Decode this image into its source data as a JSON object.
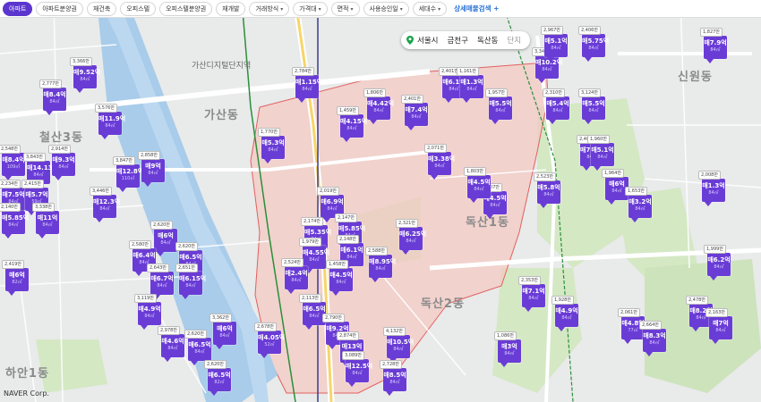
{
  "filters": [
    {
      "label": "아파트",
      "active": true,
      "dropdown": false
    },
    {
      "label": "아파트분양권",
      "active": false,
      "dropdown": false
    },
    {
      "label": "재건축",
      "active": false,
      "dropdown": false
    },
    {
      "label": "오피스텔",
      "active": false,
      "dropdown": false
    },
    {
      "label": "오피스텔분양권",
      "active": false,
      "dropdown": false
    },
    {
      "label": "재개발",
      "active": false,
      "dropdown": false
    },
    {
      "label": "거래방식",
      "active": false,
      "dropdown": true
    },
    {
      "label": "가격대",
      "active": false,
      "dropdown": true
    },
    {
      "label": "면적",
      "active": false,
      "dropdown": true
    },
    {
      "label": "사용승인일",
      "active": false,
      "dropdown": true
    },
    {
      "label": "세대수",
      "active": false,
      "dropdown": true
    }
  ],
  "advanced_search_label": "상세매물검색 +",
  "search": {
    "city": "서울시",
    "district": "금천구",
    "dong": "독산동",
    "suffix": "단지"
  },
  "area_labels": [
    {
      "text": "가산동"
    },
    {
      "text": "철산3동"
    },
    {
      "text": "독산2동"
    },
    {
      "text": "독산1동"
    },
    {
      "text": "신원동"
    },
    {
      "text": "하안1동"
    },
    {
      "text": "가산디지털단지역"
    }
  ],
  "markers": [
    {
      "value": "매9.52억",
      "area": "84㎡",
      "price": "3,366만"
    },
    {
      "value": "매8.4억",
      "area": "84㎡",
      "price": "2,777만"
    },
    {
      "value": "매11.9억",
      "area": "84㎡",
      "price": "3,576만"
    },
    {
      "value": "매8.4억",
      "area": "109㎡",
      "price": "2,548만"
    },
    {
      "value": "매14.13억",
      "area": "84㎡",
      "price": "3,843만"
    },
    {
      "value": "매9.3억",
      "area": "84㎡",
      "price": "2,914만"
    },
    {
      "value": "매7.5억",
      "area": "84㎡",
      "price": "2,234만"
    },
    {
      "value": "매5.7억",
      "area": "59㎡",
      "price": "2,415만"
    },
    {
      "value": "매12.8억",
      "area": "110㎡",
      "price": "3,847만"
    },
    {
      "value": "매9억",
      "area": "84㎡",
      "price": "2,858만"
    },
    {
      "value": "매12.3억",
      "area": "84㎡",
      "price": "3,446만"
    },
    {
      "value": "매5.85억",
      "area": "84㎡",
      "price": "2,140만"
    },
    {
      "value": "매11억",
      "area": "84㎡",
      "price": "3,338만"
    },
    {
      "value": "매6억",
      "area": "84㎡",
      "price": "2,620만"
    },
    {
      "value": "매6.4억",
      "area": "84㎡",
      "price": "2,580만"
    },
    {
      "value": "매6.5억",
      "area": "84㎡",
      "price": "2,620만"
    },
    {
      "value": "매6억",
      "area": "82㎡",
      "price": "2,419만"
    },
    {
      "value": "매6.7억",
      "area": "84㎡",
      "price": "2,643만"
    },
    {
      "value": "매6.15억",
      "area": "84㎡",
      "price": "2,651만"
    },
    {
      "value": "매4.9억",
      "area": "84㎡",
      "price": "3,119만"
    },
    {
      "value": "매4.6억",
      "area": "84㎡",
      "price": "2,978만"
    },
    {
      "value": "매6.5억",
      "area": "84㎡",
      "price": "2,620만"
    },
    {
      "value": "매6억",
      "area": "84㎡",
      "price": "3,362만"
    },
    {
      "value": "매6.5억",
      "area": "82㎡",
      "price": "2,620만"
    },
    {
      "value": "매4.05억",
      "area": "52㎡",
      "price": "2,678만"
    },
    {
      "value": "매1.15억",
      "area": "84㎡",
      "price": "2,784만"
    },
    {
      "value": "매5.3억",
      "area": "84㎡",
      "price": "1,770만"
    },
    {
      "value": "매4.15억",
      "area": "84㎡",
      "price": "1,459만"
    },
    {
      "value": "매6.9억",
      "area": "84㎡",
      "price": "2,019만"
    },
    {
      "value": "매5.35억",
      "area": "84㎡",
      "price": "2,174만"
    },
    {
      "value": "매5.85억",
      "area": "84㎡",
      "price": "2,147만"
    },
    {
      "value": "매4.55억",
      "area": "84㎡",
      "price": "1,979만"
    },
    {
      "value": "매6.1억",
      "area": "84㎡",
      "price": "2,148만"
    },
    {
      "value": "매2.4억",
      "area": "84㎡",
      "price": "2,524만"
    },
    {
      "value": "매6.5억",
      "area": "84㎡",
      "price": "2,113만"
    },
    {
      "value": "매8.95억",
      "area": "84㎡",
      "price": "2,588만"
    },
    {
      "value": "매4.5억",
      "area": "84㎡",
      "price": "1,458만"
    },
    {
      "value": "매9.2억",
      "area": "84㎡",
      "price": "2,790만"
    },
    {
      "value": "매13억",
      "area": "84㎡",
      "price": "2,874만"
    },
    {
      "value": "매12.5억",
      "area": "84㎡",
      "price": "3,089만"
    },
    {
      "value": "매10.5억",
      "area": "84㎡",
      "price": "4,132만"
    },
    {
      "value": "매8.5억",
      "area": "84㎡",
      "price": "2,728만"
    },
    {
      "value": "매6.25억",
      "area": "84㎡",
      "price": "2,321만"
    },
    {
      "value": "매3.38억",
      "area": "84㎡",
      "price": "2,071만"
    },
    {
      "value": "매4.5억",
      "area": "84㎡",
      "price": "1,907만"
    },
    {
      "value": "매7.4억",
      "area": "84㎡",
      "price": "2,401만"
    },
    {
      "value": "매6.1억",
      "area": "84㎡",
      "price": "2,401만"
    },
    {
      "value": "매1.3억",
      "area": "84㎡",
      "price": "1,161만"
    },
    {
      "value": "매4.42억",
      "area": "84㎡",
      "price": "1,806만"
    },
    {
      "value": "매5.5억",
      "area": "84㎡",
      "price": "1,957만"
    },
    {
      "value": "매4.5억",
      "area": "84㎡",
      "price": "1,803만"
    },
    {
      "value": "매10.2억",
      "area": "84㎡",
      "price": "3,342만"
    },
    {
      "value": "매5.1억",
      "area": "84㎡",
      "price": "2,967만"
    },
    {
      "value": "매5.75억",
      "area": "84㎡",
      "price": "2,406만"
    },
    {
      "value": "매5.4억",
      "area": "84㎡",
      "price": "2,310만"
    },
    {
      "value": "매5.5억",
      "area": "84㎡",
      "price": "3,124만"
    },
    {
      "value": "매7.55억",
      "area": "84㎡",
      "price": "2,400만"
    },
    {
      "value": "매6억",
      "area": "84㎡",
      "price": "1,964만"
    },
    {
      "value": "매3.2억",
      "area": "84㎡",
      "price": "1,653만"
    },
    {
      "value": "매5.8억",
      "area": "84㎡",
      "price": "2,523만"
    },
    {
      "value": "매1.3억",
      "area": "84㎡",
      "price": "2,008만"
    },
    {
      "value": "매7.1억",
      "area": "84㎡",
      "price": "2,353만"
    },
    {
      "value": "매4.9억",
      "area": "84㎡",
      "price": "1,928만"
    },
    {
      "value": "매3억",
      "area": "84㎡",
      "price": "1,086만"
    },
    {
      "value": "매4.8억",
      "area": "77㎡",
      "price": "2,061만"
    },
    {
      "value": "매8.3억",
      "area": "84㎡",
      "price": "2,664만"
    },
    {
      "value": "매8.2억",
      "area": "84㎡",
      "price": "2,478만"
    },
    {
      "value": "매7억",
      "area": "84㎡",
      "price": "2,163만"
    },
    {
      "value": "매6.2억",
      "area": "84㎡",
      "price": "1,999만"
    },
    {
      "value": "매5.1억",
      "area": "84㎡",
      "price": "1,960만"
    },
    {
      "value": "매7.9억",
      "area": "84㎡",
      "price": "1,827만"
    }
  ],
  "attribution": "NAVER Corp."
}
